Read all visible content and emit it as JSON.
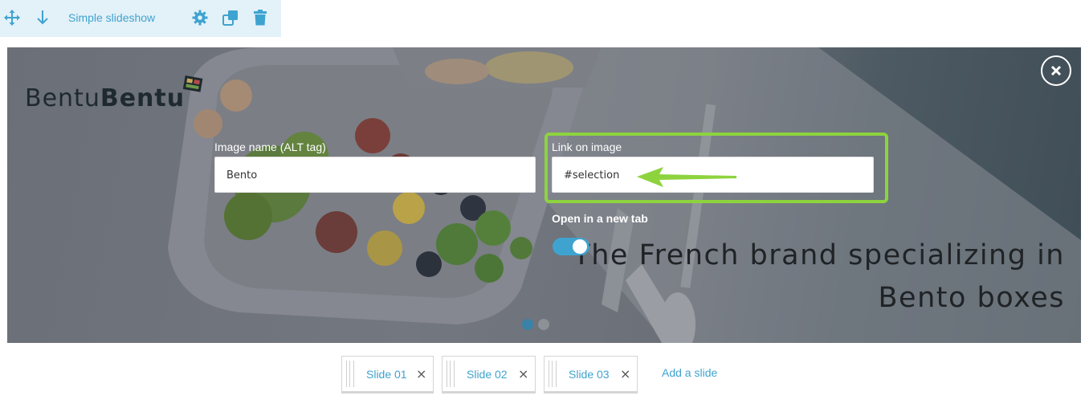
{
  "toolbar": {
    "title": "Simple slideshow",
    "icons": [
      "move-icon",
      "arrow-down-icon",
      "gear-icon",
      "duplicate-icon",
      "trash-icon"
    ]
  },
  "slide": {
    "logo": {
      "light": "Bentu",
      "bold": "Bentu"
    },
    "alt_field": {
      "label": "Image name (ALT tag)",
      "value": "Bento"
    },
    "link_field": {
      "label": "Link on image",
      "value": "#selection"
    },
    "new_tab": {
      "label": "Open in a new tab",
      "enabled": true
    },
    "headline": [
      "The French brand specializing in",
      "Bento boxes"
    ],
    "active_dot": 1,
    "dot_count": 2
  },
  "tabs": [
    {
      "label": "Slide 01"
    },
    {
      "label": "Slide 02"
    },
    {
      "label": "Slide 03"
    }
  ],
  "add_slide_label": "Add a slide",
  "colors": {
    "accent": "#3fa3d0",
    "highlight": "#8dd33e",
    "toolbar_bg": "#e3f1f8"
  }
}
